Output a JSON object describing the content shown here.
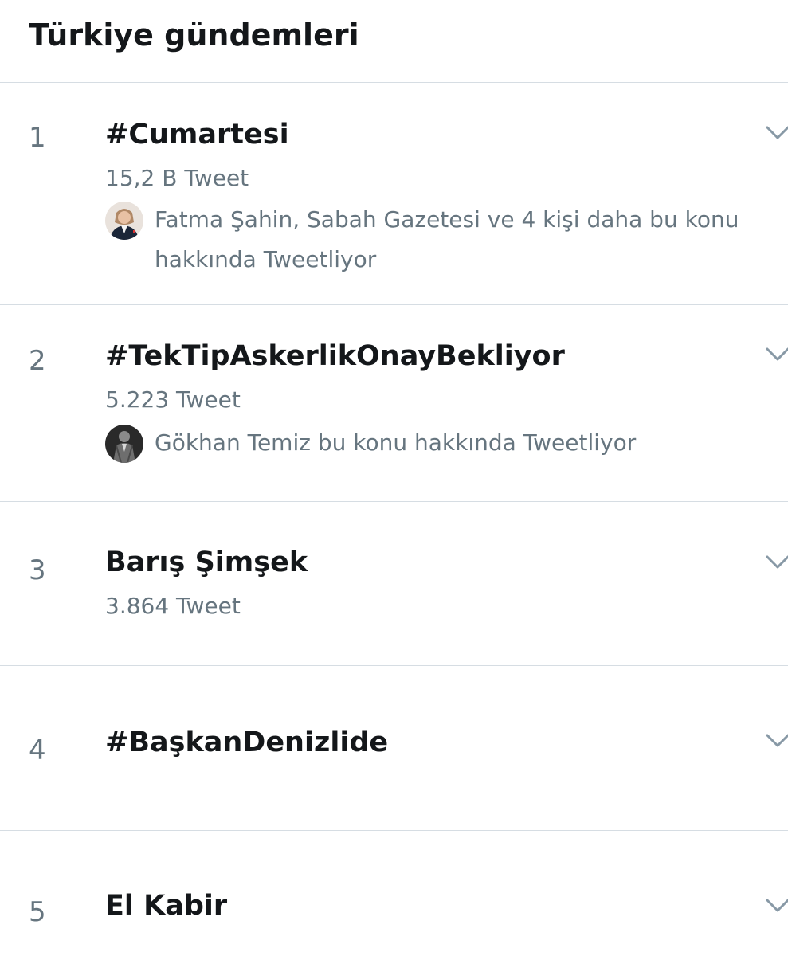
{
  "header": {
    "title": "Türkiye gündemleri"
  },
  "trends": [
    {
      "rank": "1",
      "name": "#Cumartesi",
      "count": "15,2 B Tweet",
      "context": "Fatma Şahin, Sabah Gazetesi ve 4 kişi daha bu konu hakkında Tweetliyor"
    },
    {
      "rank": "2",
      "name": "#TekTipAskerlikOnayBekliyor",
      "count": "5.223 Tweet",
      "context": "Gökhan Temiz bu konu hakkında Tweetliyor"
    },
    {
      "rank": "3",
      "name": "Barış Şimşek",
      "count": "3.864 Tweet"
    },
    {
      "rank": "4",
      "name": "#BaşkanDenizlide"
    },
    {
      "rank": "5",
      "name": "El Kabir"
    }
  ],
  "colors": {
    "primary_text": "#14171a",
    "secondary_text": "#66757f",
    "divider": "#d6dde3",
    "chevron": "#8899a6"
  },
  "icons": {
    "more": "chevron-down-icon"
  }
}
